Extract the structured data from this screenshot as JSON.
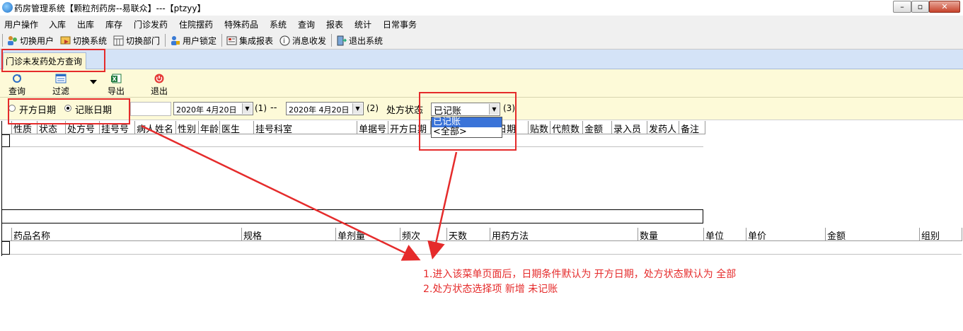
{
  "window": {
    "title": "药房管理系统【颗粒剂药房--易联众】---【ptzyy】",
    "controls": [
      "–",
      "▫",
      "✕"
    ]
  },
  "menu": [
    "用户操作",
    "入库",
    "出库",
    "库存",
    "门诊发药",
    "住院摆药",
    "特殊药品",
    "系统",
    "查询",
    "报表",
    "统计",
    "日常事务"
  ],
  "toolbar": [
    {
      "label": "切换用户",
      "icon": "switch-user-icon"
    },
    {
      "label": "切换系统",
      "icon": "switch-system-icon"
    },
    {
      "label": "切换部门",
      "icon": "switch-department-icon"
    },
    {
      "label": "用户锁定",
      "icon": "user-lock-icon"
    },
    {
      "label": "集成报表",
      "icon": "report-icon"
    },
    {
      "label": "消息收发",
      "icon": "message-icon"
    },
    {
      "label": "退出系统",
      "icon": "exit-icon"
    }
  ],
  "tab": {
    "label": "门诊未发药处方查询"
  },
  "actions": {
    "query": "查询(R)",
    "filter": "过滤(F)",
    "export": "导出(E)",
    "exit": "退出(X)"
  },
  "filters": {
    "radio_open": "开方日期",
    "radio_booked": "记账日期",
    "selected_radio": "记账日期",
    "date_from": "2020年 4月20日",
    "date_to": "2020年 4月20日",
    "marker1": "(1)",
    "range_sep": "--",
    "marker2": "(2)",
    "status_label": "处方状态",
    "status_value": "已记账",
    "marker3": "(3)",
    "status_options": [
      "已记账",
      "<全部>"
    ]
  },
  "grid1": {
    "columns": [
      "性质",
      "状态",
      "处方号",
      "挂号号",
      "病人姓名",
      "性别",
      "年龄",
      "医生",
      "挂号科室",
      "单据号",
      "开方日期",
      "",
      "记账日期",
      "贴数",
      "代煎数",
      "金额",
      "录入员",
      "发药人",
      "备注"
    ]
  },
  "grid2": {
    "columns": [
      "药品名称",
      "规格",
      "单剂量",
      "频次",
      "天数",
      "用药方法",
      "数量",
      "单位",
      "单价",
      "金额",
      "组别"
    ]
  },
  "annotation": {
    "line1": "1.进入该菜单页面后，日期条件默认为  开方日期，处方状态默认为 全部",
    "line2": "2.处方状态选择项 新增  未记账"
  },
  "colors": {
    "annotation_red": "#e52b2b",
    "tab_bg": "#d4e3f7",
    "panel_bg": "#fdfad8",
    "selection_blue": "#3a73d8"
  }
}
